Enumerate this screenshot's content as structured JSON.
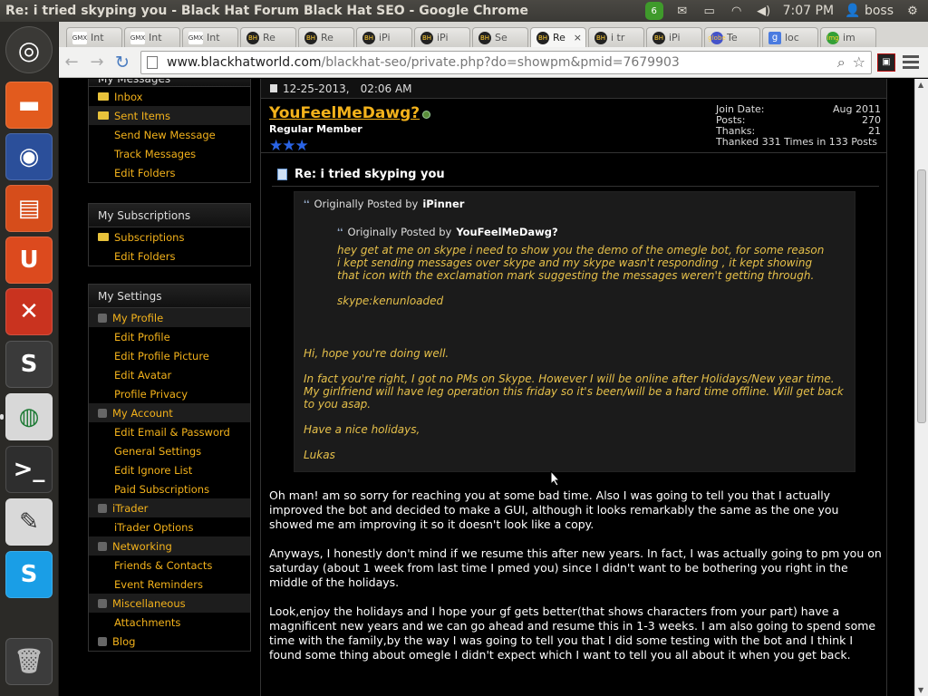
{
  "window": {
    "title": "Re: i tried skyping you - Black Hat Forum Black Hat SEO - Google Chrome"
  },
  "tray": {
    "badge_count": "6",
    "clock": "7:07 PM",
    "user": "boss"
  },
  "tabs": [
    {
      "label": "Int",
      "favicon": "GMX",
      "active": false
    },
    {
      "label": "Int",
      "favicon": "GMX",
      "active": false
    },
    {
      "label": "Int",
      "favicon": "GMX",
      "active": false
    },
    {
      "label": "Re",
      "favicon": "BH",
      "active": false
    },
    {
      "label": "Re",
      "favicon": "BH",
      "active": false
    },
    {
      "label": "iPi",
      "favicon": "BH",
      "active": false
    },
    {
      "label": "iPi",
      "favicon": "BH",
      "active": false
    },
    {
      "label": "Se",
      "favicon": "BH",
      "active": false
    },
    {
      "label": "Re",
      "favicon": "BH",
      "active": true
    },
    {
      "label": "i tr",
      "favicon": "BH",
      "active": false
    },
    {
      "label": "iPi",
      "favicon": "BH",
      "active": false
    },
    {
      "label": "Te",
      "favicon": "globe",
      "active": false
    },
    {
      "label": "loc",
      "favicon": "g",
      "active": false
    },
    {
      "label": "im",
      "favicon": "img",
      "active": false
    }
  ],
  "address": {
    "host": "www.blackhatworld.com",
    "path": "/blackhat-seo/private.php?do=showpm&pmid=7679903"
  },
  "sidebar": {
    "messages": {
      "title": "My Messages",
      "items": [
        {
          "label": "Inbox",
          "icon": "folder-icon",
          "sub": false,
          "hl": false
        },
        {
          "label": "Sent Items",
          "icon": "folder-icon",
          "sub": false,
          "hl": true
        },
        {
          "label": "Send New Message",
          "icon": "",
          "sub": true,
          "hl": false
        },
        {
          "label": "Track Messages",
          "icon": "",
          "sub": true,
          "hl": false
        },
        {
          "label": "Edit Folders",
          "icon": "",
          "sub": true,
          "hl": false
        }
      ]
    },
    "subscriptions": {
      "title": "My Subscriptions",
      "items": [
        {
          "label": "Subscriptions",
          "icon": "folder-icon",
          "sub": false,
          "hl": false
        },
        {
          "label": "Edit Folders",
          "icon": "",
          "sub": true,
          "hl": false
        }
      ]
    },
    "settings": {
      "title": "My Settings",
      "items": [
        {
          "label": "My Profile",
          "icon": "profile-icon",
          "sub": false,
          "hl": true
        },
        {
          "label": "Edit Profile",
          "icon": "",
          "sub": true,
          "hl": false
        },
        {
          "label": "Edit Profile Picture",
          "icon": "",
          "sub": true,
          "hl": false
        },
        {
          "label": "Edit Avatar",
          "icon": "",
          "sub": true,
          "hl": false
        },
        {
          "label": "Profile Privacy",
          "icon": "",
          "sub": true,
          "hl": false
        },
        {
          "label": "My Account",
          "icon": "lock-icon",
          "sub": false,
          "hl": true
        },
        {
          "label": "Edit Email & Password",
          "icon": "",
          "sub": true,
          "hl": false
        },
        {
          "label": "General Settings",
          "icon": "",
          "sub": true,
          "hl": false
        },
        {
          "label": "Edit Ignore List",
          "icon": "",
          "sub": true,
          "hl": false
        },
        {
          "label": "Paid Subscriptions",
          "icon": "",
          "sub": true,
          "hl": false
        },
        {
          "label": "iTrader",
          "icon": "itrader-icon",
          "sub": false,
          "hl": true
        },
        {
          "label": "iTrader Options",
          "icon": "",
          "sub": true,
          "hl": false
        },
        {
          "label": "Networking",
          "icon": "network-icon",
          "sub": false,
          "hl": true
        },
        {
          "label": "Friends & Contacts",
          "icon": "",
          "sub": true,
          "hl": false
        },
        {
          "label": "Event Reminders",
          "icon": "",
          "sub": true,
          "hl": false
        },
        {
          "label": "Miscellaneous",
          "icon": "misc-icon",
          "sub": false,
          "hl": true
        },
        {
          "label": "Attachments",
          "icon": "",
          "sub": true,
          "hl": false
        },
        {
          "label": "Blog",
          "icon": "blog-icon",
          "sub": false,
          "hl": false
        }
      ]
    }
  },
  "post": {
    "date": "12-25-2013,",
    "time": "02:06 AM",
    "username": "YouFeelMeDawg?",
    "user_title": "Regular Member",
    "stars": "★★★",
    "stats": [
      {
        "label": "Join Date:",
        "value": "Aug 2011"
      },
      {
        "label": "Posts:",
        "value": "270"
      },
      {
        "label": "Thanks:",
        "value": "21"
      }
    ],
    "thanked": "Thanked 331 Times in 133 Posts",
    "title": "Re: i tried skyping you",
    "quote": {
      "prefix": "Originally Posted by",
      "author": "iPinner",
      "inner": {
        "prefix": "Originally Posted by",
        "author": "YouFeelMeDawg?",
        "paragraphs": [
          "hey get at me on skype i need to show you the demo of the omegle bot, for some reason i kept sending messages over skype and my skype wasn't responding , it kept showing that icon with the exclamation mark suggesting the messages weren't getting through.",
          "skype:kenunloaded"
        ]
      },
      "paragraphs": [
        "Hi, hope you're doing well.",
        "In fact you're right, I got no PMs on Skype. However I will be online after Holidays/New year time. My girlfriend will have leg operation this friday so it's been/will be a hard time offline. Will get back to you asap.",
        "Have a nice holidays,",
        "Lukas"
      ]
    },
    "body": [
      "Oh man! am so sorry for reaching you at some bad time. Also I was going to tell you that I actually improved the bot and decided to make a GUI, although it looks remarkably the same as the one you showed me am improving it so it doesn't look like a copy.",
      "Anyways, I honestly don't mind if we resume this after new years. In fact, I was actually going to pm you on saturday (about 1 week from last time I pmed you) since I didn't want to be bothering you right in the middle of the holidays.",
      "Look,enjoy the holidays and I hope your gf gets better(that shows characters from your part) have a magnificent new years and we can go ahead and resume this in 1-3 weeks. I am also going to spend some time with the family,by the way I was going to tell you that I did some testing with the bot and I think I found some thing about omegle I didn't expect which I want to tell you all about it when you get back."
    ]
  }
}
